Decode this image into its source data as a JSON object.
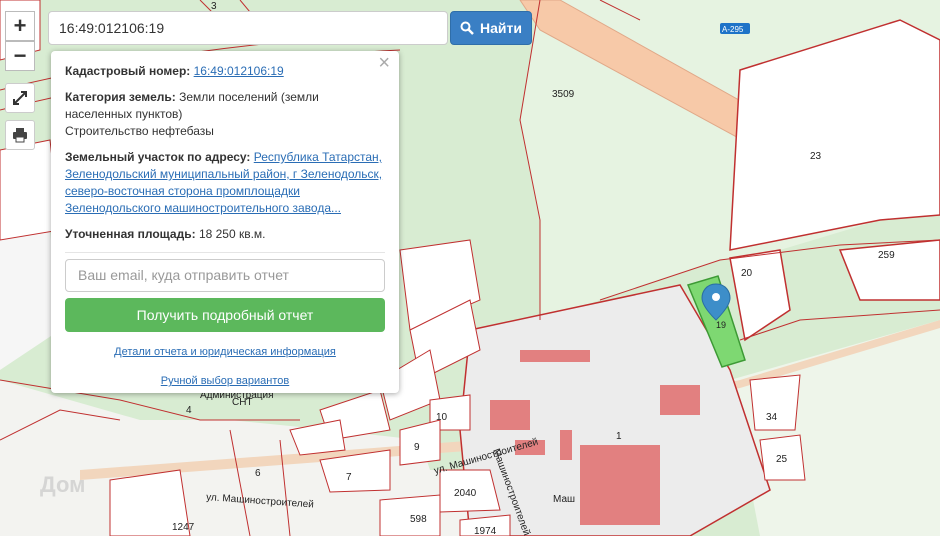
{
  "search": {
    "value": "16:49:012106:19",
    "button_label": "Найти"
  },
  "zoom": {
    "in_label": "+",
    "out_label": "−"
  },
  "tools": {
    "fullscreen_icon": "expand-icon",
    "print_icon": "printer-icon"
  },
  "popup": {
    "close_label": "×",
    "cadastral_label": "Кадастровый номер:",
    "cadastral_value": "16:49:012106:19",
    "category_label": "Категория земель:",
    "category_value": "Земли поселений (земли населенных пунктов)",
    "category_use": "Строительство нефтебазы",
    "address_label": "Земельный участок по адресу:",
    "address_value": "Республика Татарстан, Зеленодольский муниципальный район, г Зеленодольск, северо-восточная сторона промплощадки Зеленодольского машиностроительного завода...",
    "area_label": "Уточненная площадь:",
    "area_value": "18 250 кв.м.",
    "email_placeholder": "Ваш email, куда отправить отчет",
    "report_button": "Получить подробный отчет",
    "details_link": "Детали отчета и юридическая информация",
    "manual_link": "Ручной выбор вариантов"
  },
  "map_labels": {
    "l3509": "3509",
    "l23": "23",
    "l20": "20",
    "l259": "259",
    "l1": "1",
    "l10": "10",
    "l9": "9",
    "l7": "7",
    "l6": "6",
    "l4": "4",
    "l2040": "2040",
    "l598": "598",
    "l1974": "1974",
    "l34": "34",
    "l25": "25",
    "l1247": "1247",
    "l3": "3",
    "road_shield": "А-295",
    "street1": "ул. Машиностроителей",
    "street2": "ул. Машиностроителей",
    "street3": "Машиностроителей",
    "snt": "СНТ",
    "admin": "Администрация",
    "mash": "Маш",
    "parcel": "19"
  },
  "watermark": "Дом"
}
